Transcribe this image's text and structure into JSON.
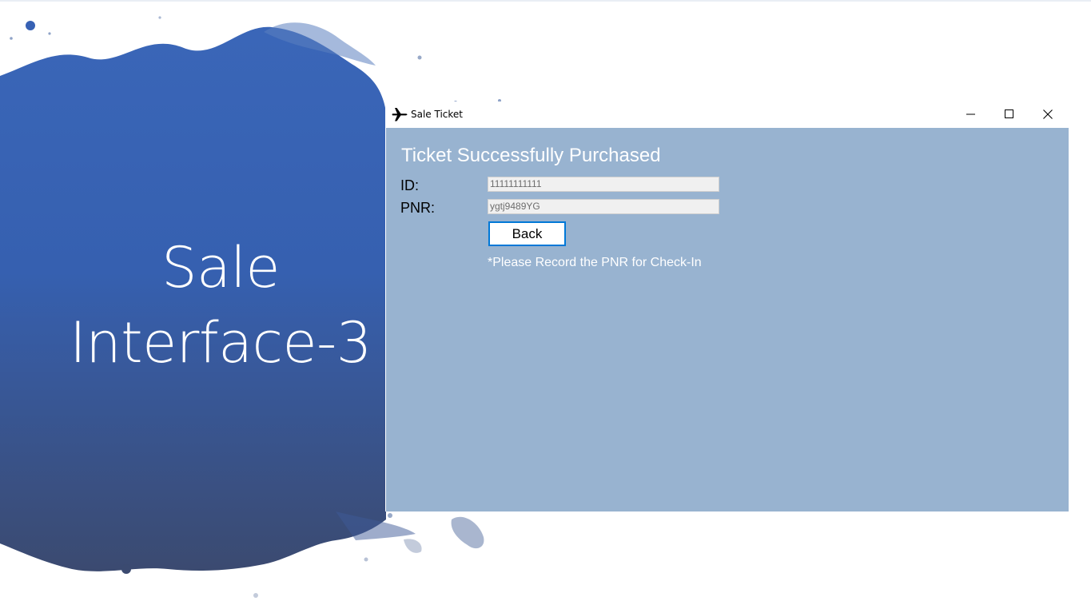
{
  "slide": {
    "title_line1": "Sale",
    "title_line2": "Interface-3"
  },
  "window": {
    "title": "Sale Ticket",
    "app_icon": "airplane-icon",
    "controls": [
      "minimize-icon",
      "maximize-icon",
      "close-icon"
    ]
  },
  "form": {
    "heading": "Ticket Successfully Purchased",
    "id_label": "ID:",
    "id_value": "11111111111",
    "pnr_label": "PNR:",
    "pnr_value": "ygtj9489YG",
    "back_label": "Back",
    "note": "*Please Record the PNR for Check-In"
  },
  "colors": {
    "client_bg": "#98b3d0",
    "paint_top": "#3761b4",
    "paint_bottom": "#3a4a72",
    "button_border": "#0078d7"
  }
}
